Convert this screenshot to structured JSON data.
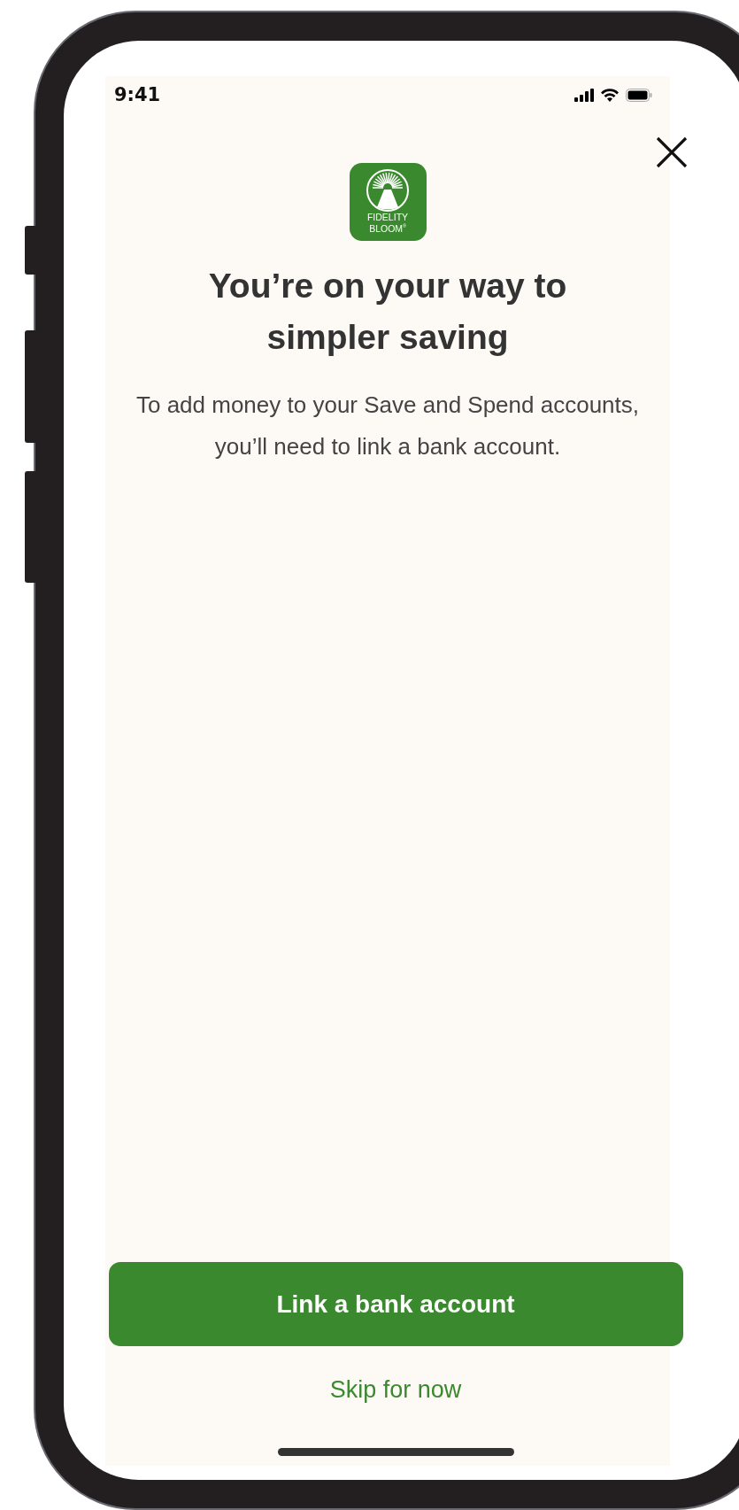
{
  "status_bar": {
    "time": "9:41"
  },
  "logo": {
    "line_1": "FIDELITY",
    "line_2": "BLOOM$^{®}$"
  },
  "title": "You’re on your way to simpler saving",
  "message": "To add money to your Save and Spend accounts, you’ll need to link a bank account.",
  "primary_button": "Link a bank account",
  "secondary_link": "Skip for now"
}
